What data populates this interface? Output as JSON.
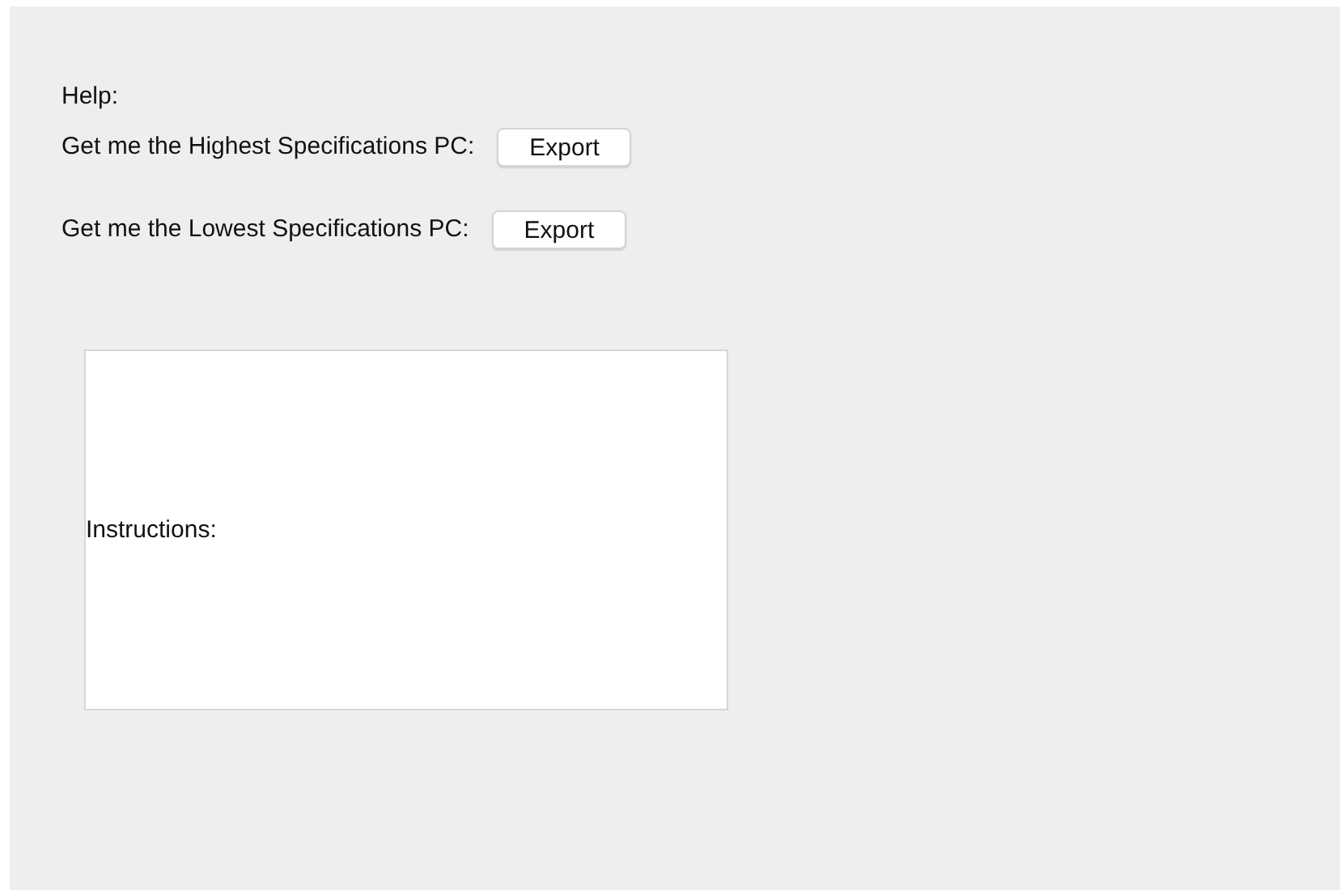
{
  "help_label": "Help:",
  "rows": [
    {
      "label": "Get me the Highest Specifications PC:",
      "button": "Export"
    },
    {
      "label": "Get me the Lowest Specifications PC:",
      "button": "Export"
    }
  ],
  "instructions": {
    "label": "Instructions:"
  }
}
